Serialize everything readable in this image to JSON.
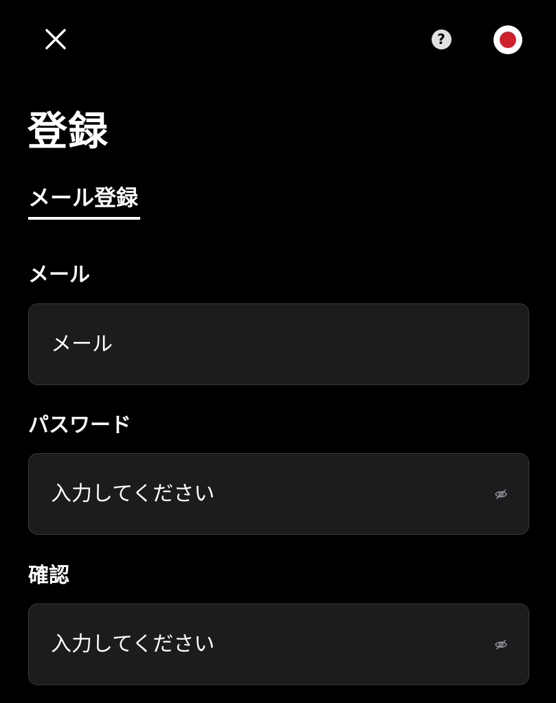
{
  "page": {
    "title": "登録"
  },
  "tabs": [
    {
      "label": "メール登録",
      "active": true
    }
  ],
  "form": {
    "email": {
      "label": "メール",
      "placeholder": "メール",
      "value": ""
    },
    "password": {
      "label": "パスワード",
      "placeholder": "入力してください",
      "value": ""
    },
    "confirm": {
      "label": "確認",
      "placeholder": "入力してください",
      "value": ""
    }
  },
  "header": {
    "close_icon": "close-icon",
    "help_icon": "help-icon",
    "help_glyph": "?",
    "record_icon": "record-icon"
  },
  "colors": {
    "background": "#000000",
    "field_background": "#1c1c1e",
    "field_border": "#3a3a3c",
    "record_red": "#d0202c",
    "text": "#ffffff",
    "eye_icon": "#8e8e93"
  }
}
